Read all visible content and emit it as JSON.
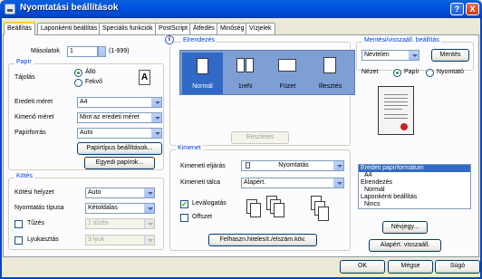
{
  "window": {
    "title": "Nyomtatási beállítások",
    "help_label": "?",
    "close_label": "X"
  },
  "tabs": [
    "Beállítás",
    "Laponkénti beállítás",
    "Speciális funkciók",
    "PostScript",
    "Átfedés",
    "Minőség",
    "Vízjelek"
  ],
  "copies": {
    "label": "Másolatok",
    "value": "1",
    "range": "(1-999)"
  },
  "paper": {
    "group_label": "Papír",
    "orientation_label": "Tájolás",
    "orientation_options": [
      "Álló",
      "Fekvő"
    ],
    "orientation_selected": "Álló",
    "original_size_label": "Eredeti méret",
    "original_size_value": "A4",
    "output_size_label": "Kimenő méret",
    "output_size_value": "Mint az eredeti méret",
    "paper_source_label": "Papírforrás",
    "paper_source_value": "Auto",
    "paper_type_button": "Papírtípus beállítások...",
    "other_papers_button": "Egyedi papírok..."
  },
  "binding": {
    "group_label": "Kötés",
    "position_label": "Kötési helyzet",
    "position_value": "Auto",
    "print_type_label": "Nyomtatás típusa",
    "print_type_value": "Kétoldalas",
    "staple_label": "Tűzés",
    "staple_value": "1 tűzés",
    "staple_checked": false,
    "punch_label": "Lyukasztás",
    "punch_value": "3 lyuk",
    "punch_checked": false
  },
  "layout": {
    "group_label": "Elrendezés",
    "items": [
      "Normál",
      "1reN",
      "Füzet",
      "Illesztés"
    ],
    "selected": "Normál",
    "details_button": "Részletes"
  },
  "output": {
    "group_label": "Kimenet",
    "output_method_label": "Kimeneti eljárás",
    "output_method_value": "Nyomtatás",
    "output_tray_label": "Kimeneti tálca",
    "output_tray_value": "Alapért.",
    "collate_label": "Leválogatás",
    "collate_checked": true,
    "offset_label": "Offszet",
    "offset_checked": false,
    "user_auth_button": "Felhaszn.hitelesít./elszám.köv."
  },
  "favorites": {
    "group_label": "Mentési/visszaáll. beállítás",
    "value": "Névtelen",
    "save_button": "Mentés"
  },
  "view": {
    "label": "Nézet",
    "options": [
      "Papír",
      "Nyomtató"
    ],
    "selected": "Papír"
  },
  "summary_list": [
    "Eredeti papírformátum",
    "A4",
    "Elrendezés",
    "Normál",
    "Laponkénti beállítás",
    "Nincs"
  ],
  "version_button": "Névjegy...",
  "default_button": "Alapért. visszaáll.",
  "footer": {
    "ok": "OK",
    "cancel": "Mégse",
    "help": "Súgó"
  },
  "colors": {
    "title_bar": "#0054e3",
    "group_label": "#0046d5",
    "selection": "#316ac5",
    "layout_strip": "#7d9fd3"
  }
}
